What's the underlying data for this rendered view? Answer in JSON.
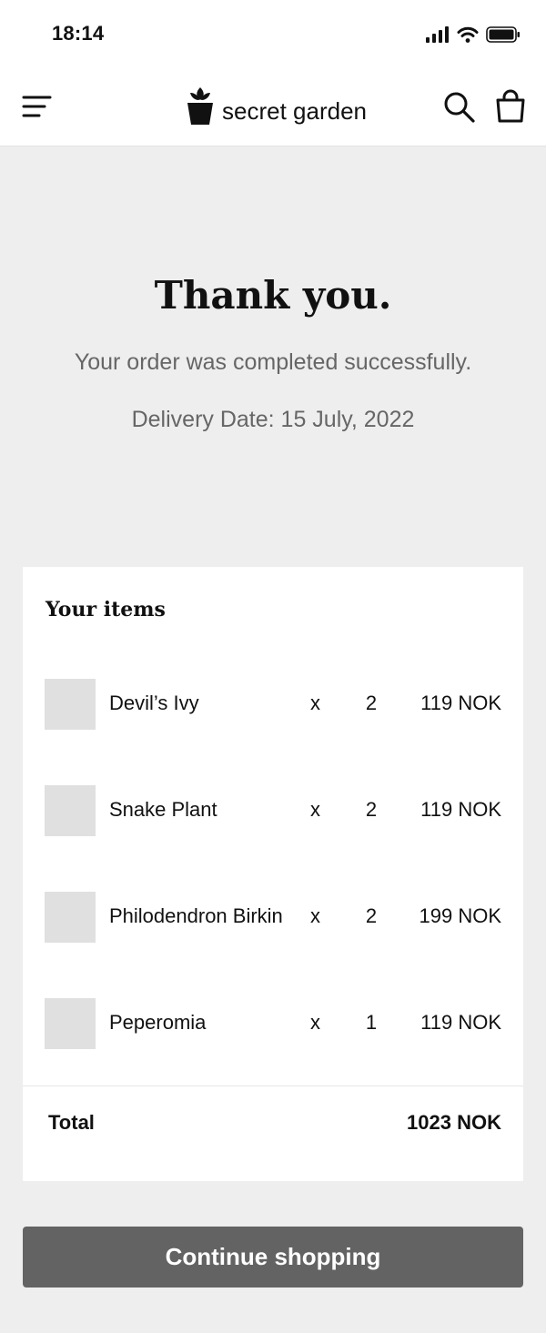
{
  "status_bar": {
    "time": "18:14"
  },
  "header": {
    "brand": "secret garden",
    "icons": [
      "menu-icon",
      "plant-pot-logo-icon",
      "search-icon",
      "shopping-bag-icon"
    ]
  },
  "confirmation": {
    "title": "Thank you.",
    "subtitle": "Your order was completed successfully.",
    "delivery": "Delivery Date: 15 July, 2022"
  },
  "order": {
    "heading": "Your items",
    "items": [
      {
        "name": "Devil’s Ivy",
        "x": "x",
        "qty": "2",
        "price": "119 NOK"
      },
      {
        "name": "Snake Plant",
        "x": "x",
        "qty": "2",
        "price": "119 NOK"
      },
      {
        "name": "Philodendron Birkin",
        "x": "x",
        "qty": "2",
        "price": "199 NOK"
      },
      {
        "name": "Peperomia",
        "x": "x",
        "qty": "1",
        "price": "119 NOK"
      }
    ],
    "total_label": "Total",
    "total_value": "1023 NOK"
  },
  "cta": {
    "label": "Continue shopping"
  },
  "colors": {
    "background": "#eeeeee",
    "card": "#ffffff",
    "button": "#636363",
    "muted_text": "#666666",
    "thumbnail": "#e0e0e0"
  }
}
